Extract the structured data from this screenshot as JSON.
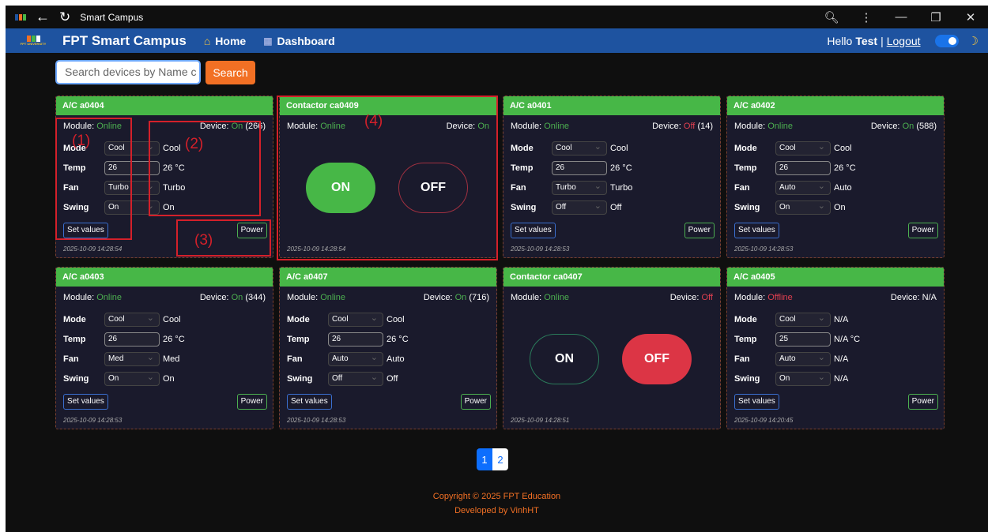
{
  "window": {
    "title": "Smart Campus"
  },
  "navbar": {
    "brand": "FPT Smart Campus",
    "logo_text": "FPT UNIVERSITY",
    "home": "Home",
    "dashboard": "Dashboard",
    "hello": "Hello",
    "user": "Test",
    "sep": "|",
    "logout": "Logout"
  },
  "search": {
    "placeholder": "Search devices by Name c",
    "button": "Search"
  },
  "labels": {
    "module": "Module:",
    "device": "Device:",
    "mode": "Mode",
    "temp": "Temp",
    "fan": "Fan",
    "swing": "Swing",
    "set_values": "Set values",
    "power": "Power",
    "on": "ON",
    "off": "OFF"
  },
  "cards": [
    {
      "title": "A/C a0404",
      "module": "Online",
      "device_state": "On",
      "device_extra": "(266)",
      "mode_sel": "Cool",
      "mode": "Cool",
      "temp_in": "26",
      "temp": "26 °C",
      "fan_sel": "Turbo",
      "fan": "Turbo",
      "swing_sel": "On",
      "swing": "On",
      "ts": "2025-10-09 14:28:54"
    },
    {
      "title": "Contactor ca0409",
      "module": "Online",
      "device_state": "On",
      "ts": "2025-10-09 14:28:54"
    },
    {
      "title": "A/C a0401",
      "module": "Online",
      "device_state": "Off",
      "device_extra": "(14)",
      "mode_sel": "Cool",
      "mode": "Cool",
      "temp_in": "26",
      "temp": "26 °C",
      "fan_sel": "Turbo",
      "fan": "Turbo",
      "swing_sel": "Off",
      "swing": "Off",
      "ts": "2025-10-09 14:28:53"
    },
    {
      "title": "A/C a0402",
      "module": "Online",
      "device_state": "On",
      "device_extra": "(588)",
      "mode_sel": "Cool",
      "mode": "Cool",
      "temp_in": "26",
      "temp": "26 °C",
      "fan_sel": "Auto",
      "fan": "Auto",
      "swing_sel": "On",
      "swing": "On",
      "ts": "2025-10-09 14:28:53"
    },
    {
      "title": "A/C a0403",
      "module": "Online",
      "device_state": "On",
      "device_extra": "(344)",
      "mode_sel": "Cool",
      "mode": "Cool",
      "temp_in": "26",
      "temp": "26 °C",
      "fan_sel": "Med",
      "fan": "Med",
      "swing_sel": "On",
      "swing": "On",
      "ts": "2025-10-09 14:28:53"
    },
    {
      "title": "A/C a0407",
      "module": "Online",
      "device_state": "On",
      "device_extra": "(716)",
      "mode_sel": "Cool",
      "mode": "Cool",
      "temp_in": "26",
      "temp": "26 °C",
      "fan_sel": "Auto",
      "fan": "Auto",
      "swing_sel": "Off",
      "swing": "Off",
      "ts": "2025-10-09 14:28:53"
    },
    {
      "title": "Contactor ca0407",
      "module": "Online",
      "device_state": "Off",
      "ts": "2025-10-09 14:28:51"
    },
    {
      "title": "A/C a0405",
      "module": "Offline",
      "device_state": "N/A",
      "mode_sel": "Cool",
      "mode": "N/A",
      "temp_in": "25",
      "temp": "N/A °C",
      "fan_sel": "Auto",
      "fan": "N/A",
      "swing_sel": "On",
      "swing": "N/A",
      "ts": "2025-10-09 14:20:45"
    }
  ],
  "annotations": [
    "(1)",
    "(2)",
    "(3)",
    "(4)"
  ],
  "pagination": {
    "pages": [
      "1",
      "2"
    ],
    "current": "1"
  },
  "footer": {
    "copyright": "Copyright © 2025 FPT Education",
    "developer": "Developed by VinhHT"
  },
  "colors": {
    "header_green": "#47b747",
    "navbar_blue": "#1e53a0",
    "accent_orange": "#f27024",
    "on_green": "#4caf50",
    "off_red": "#e04050",
    "annotation_red": "#d4202a"
  }
}
